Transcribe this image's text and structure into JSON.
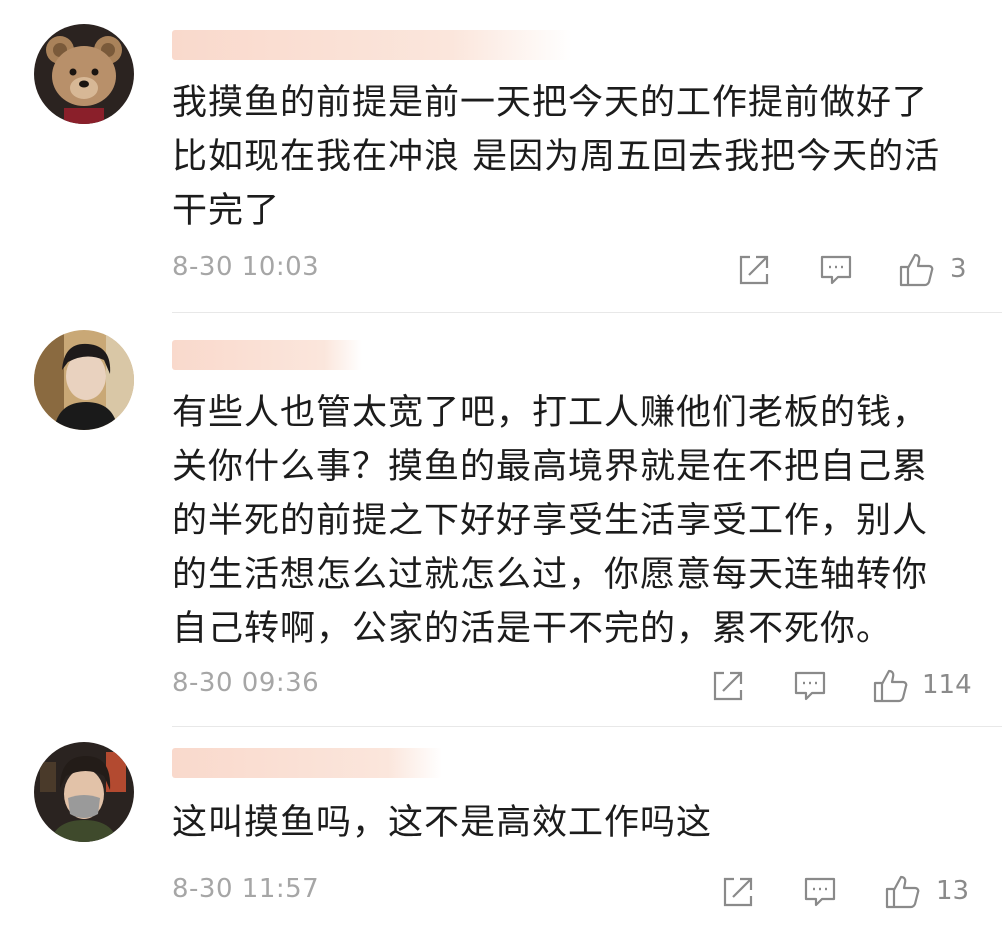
{
  "comments": [
    {
      "text": "我摸鱼的前提是前一天把今天的工作提前做好了\n比如现在我在冲浪 是因为周五回去我把今天的活\n干完了",
      "timestamp": "8-30 10:03",
      "likes": "3",
      "avatar_icon": "teddy-bear-avatar"
    },
    {
      "text": "有些人也管太宽了吧，打工人赚他们老板的钱，\n关你什么事？摸鱼的最高境界就是在不把自己累\n的半死的前提之下好好享受生活享受工作，别人\n的生活想怎么过就怎么过，你愿意每天连轴转你\n自己转啊，公家的活是干不完的，累不死你。",
      "timestamp": "8-30 09:36",
      "likes": "114",
      "avatar_icon": "man-portrait-avatar"
    },
    {
      "text": "这叫摸鱼吗，这不是高效工作吗这",
      "timestamp": "8-30 11:57",
      "likes": "13",
      "avatar_icon": "masked-man-avatar"
    }
  ],
  "colors": {
    "text": "#1c1c1c",
    "meta": "#a6a6a6",
    "icon": "#8a8a8a",
    "name_blur": "#f9d9cc"
  }
}
